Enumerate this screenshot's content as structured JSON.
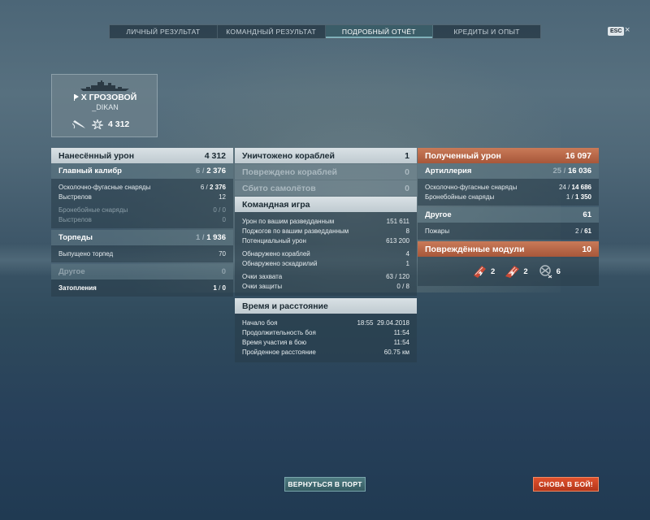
{
  "tabs": [
    {
      "label": "ЛИЧНЫЙ РЕЗУЛЬТАТ",
      "active": false
    },
    {
      "label": "КОМАНДНЫЙ РЕЗУЛЬТАТ",
      "active": false
    },
    {
      "label": "ПОДРОБНЫЙ ОТЧЁТ",
      "active": true
    },
    {
      "label": "КРЕДИТЫ И ОПЫТ",
      "active": false
    }
  ],
  "esc": {
    "key": "ESC"
  },
  "player_card": {
    "tier": "X",
    "ship_name": "ГРОЗОВОЙ",
    "player_name": "_DIKAN",
    "score": "4 312",
    "icons": [
      "torpedo-icon",
      "ship-damage-icon"
    ]
  },
  "damage_dealt": {
    "title": "Нанесённый урон",
    "total": "4 312",
    "main_battery": {
      "label": "Главный калибр",
      "hits": "6",
      "value": "2 376",
      "he_label": "Осколочно-фугасные снаряды",
      "he_hits": "6",
      "he_value": "2 376",
      "shots_label": "Выстрелов",
      "shots": "12",
      "ap_label": "Бронебойные снаряды",
      "ap_hits": "0",
      "ap_value": "0",
      "ap_shots_label": "Выстрелов",
      "ap_shots": "0"
    },
    "torpedoes": {
      "label": "Торпеды",
      "hits": "1",
      "value": "1 936",
      "launched_label": "Выпущено торпед",
      "launched": "70"
    },
    "other": {
      "label": "Другое",
      "value": "0",
      "flooding_label": "Затопления",
      "flooding_hits": "1",
      "flooding_value": "0"
    }
  },
  "kills": {
    "destroyed_label": "Уничтожено кораблей",
    "destroyed": "1",
    "damaged_label": "Повреждено кораблей",
    "damaged": "0",
    "planes_label": "Сбито самолётов",
    "planes": "0"
  },
  "team_play": {
    "title": "Командная игра",
    "rows": [
      {
        "label": "Урон по вашим разведданным",
        "value": "151 611"
      },
      {
        "label": "Поджогов по вашим разведданным",
        "value": "8"
      },
      {
        "label": "Потенциальный урон",
        "value": "613 200"
      }
    ],
    "spotting": [
      {
        "label": "Обнаружено кораблей",
        "value": "4"
      },
      {
        "label": "Обнаружено эскадрилий",
        "value": "1"
      }
    ],
    "capture": {
      "label": "Очки захвата",
      "value": "63",
      "max": "120"
    },
    "defense": {
      "label": "Очки защиты",
      "value": "0",
      "max": "8"
    }
  },
  "time_distance": {
    "title": "Время и расстояние",
    "battle_start_label": "Начало боя",
    "battle_start_time": "18:55",
    "battle_start_date": "29.04.2018",
    "duration_label": "Продолжительность боя",
    "duration": "11:54",
    "participation_label": "Время участия в бою",
    "participation": "11:54",
    "distance_label": "Пройденное расстояние",
    "distance": "60.75 км"
  },
  "damage_received": {
    "title": "Полученный урон",
    "total": "16 097",
    "artillery": {
      "label": "Артиллерия",
      "hits": "25",
      "value": "16 036",
      "he_label": "Осколочно-фугасные снаряды",
      "he_hits": "24",
      "he_value": "14 686",
      "ap_label": "Бронебойные снаряды",
      "ap_hits": "1",
      "ap_value": "1 350"
    },
    "other": {
      "label": "Другое",
      "value": "61",
      "fires_label": "Пожары",
      "fires_hits": "2",
      "fires_value": "61"
    },
    "modules": {
      "title": "Повреждённые модули",
      "total": "10",
      "items": [
        {
          "icon": "damaged-gun-icon",
          "count": "2"
        },
        {
          "icon": "damaged-torpedo-tube-icon",
          "count": "2"
        },
        {
          "icon": "damaged-aa-icon",
          "count": "6"
        }
      ]
    }
  },
  "buttons": {
    "port": "ВЕРНУТЬСЯ В ПОРТ",
    "battle": "СНОВА В БОЙ!"
  },
  "colors": {
    "header_light": "#d2dbe0",
    "header_orange": "#b8643f",
    "tab_active": "#3b5d68",
    "button_port": "#3f6a71",
    "button_battle": "#d0421f"
  }
}
